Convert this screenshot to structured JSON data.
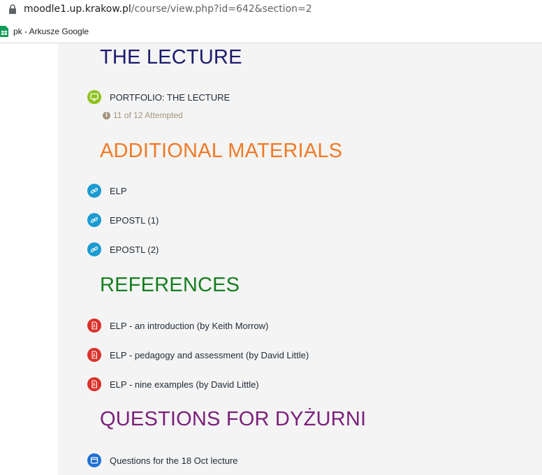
{
  "browser": {
    "url_host": "moodle1.up.krakow.pl",
    "url_path": "/course/view.php?id=642&section=2",
    "bookmark_label": "pk - Arkusze Google"
  },
  "colors": {
    "lecture_title": "#1a1a6e",
    "additional_title": "#f07a26",
    "references_title": "#157f1f",
    "questions_title": "#7b1f7b",
    "portfolio_icon": "#8fc31f",
    "url_icon": "#1a9bd1",
    "pdf_icon": "#d9322b",
    "page_icon": "#1f6fd6"
  },
  "sections": {
    "lecture": {
      "title": "THE LECTURE",
      "items": [
        {
          "label": "PORTFOLIO: THE LECTURE",
          "icon": "portfolio-icon"
        }
      ],
      "attempt_status": "11 of 12 Attempted"
    },
    "additional": {
      "title": "ADDITIONAL MATERIALS",
      "items": [
        {
          "label": "ELP",
          "icon": "link-icon"
        },
        {
          "label": "EPOSTL (1)",
          "icon": "link-icon"
        },
        {
          "label": "EPOSTL (2)",
          "icon": "link-icon"
        }
      ]
    },
    "references": {
      "title": "REFERENCES",
      "items": [
        {
          "label": "ELP - an introduction (by Keith Morrow)",
          "icon": "pdf-icon"
        },
        {
          "label": "ELP - pedagogy and assessment (by David Little)",
          "icon": "pdf-icon"
        },
        {
          "label": "ELP - nine examples (by David Little)",
          "icon": "pdf-icon"
        }
      ]
    },
    "questions": {
      "title": "QUESTIONS FOR DYŻURNI",
      "items": [
        {
          "label": "Questions for the 18 Oct lecture",
          "icon": "page-icon"
        }
      ]
    }
  }
}
